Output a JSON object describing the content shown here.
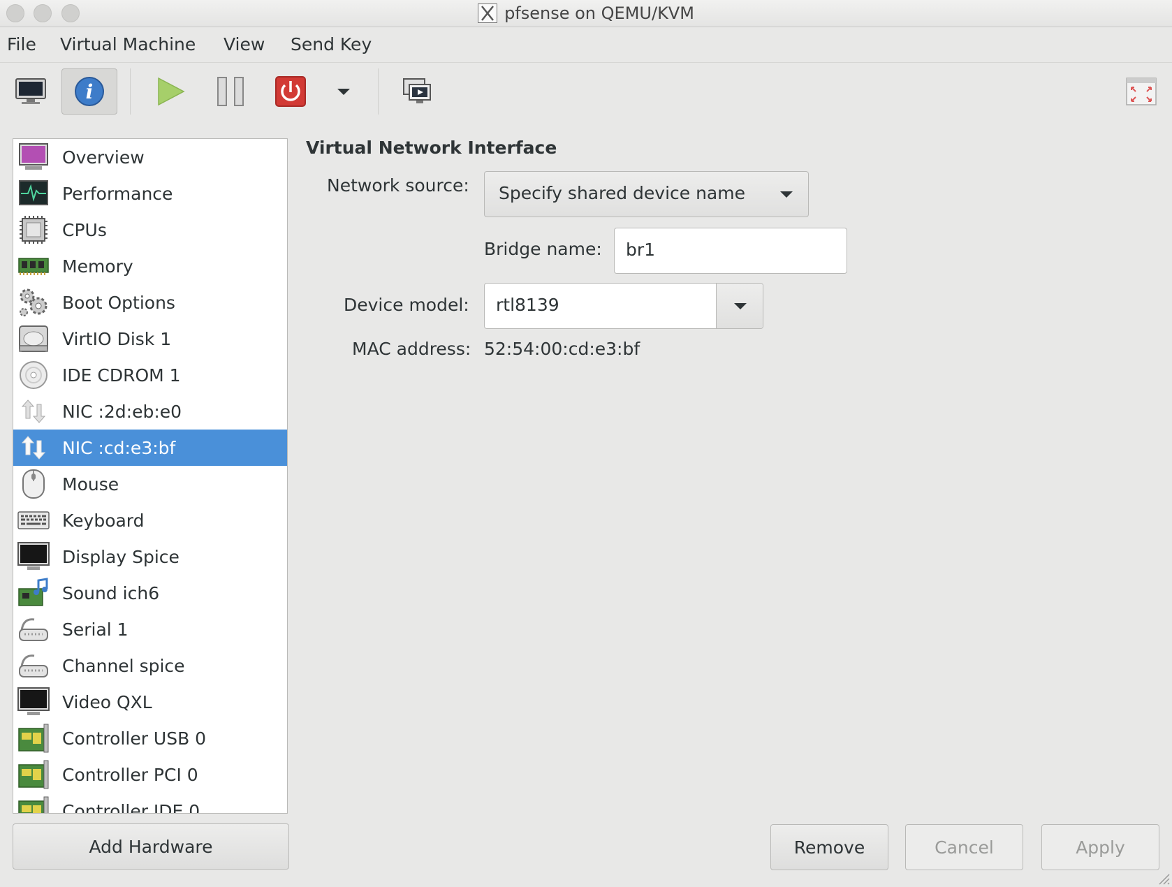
{
  "window": {
    "title": "pfsense on QEMU/KVM"
  },
  "menu": {
    "items": [
      "File",
      "Virtual Machine",
      "View",
      "Send Key"
    ]
  },
  "toolbar": {
    "buttons": [
      "console-icon",
      "info-icon",
      "play-icon",
      "pause-icon",
      "power-icon",
      "dropdown-icon",
      "snapshot-icon",
      "fullscreen-icon"
    ],
    "active": "info-icon"
  },
  "hardware": {
    "items": [
      {
        "label": "Overview",
        "icon": "overview-icon"
      },
      {
        "label": "Performance",
        "icon": "performance-icon"
      },
      {
        "label": "CPUs",
        "icon": "cpu-icon"
      },
      {
        "label": "Memory",
        "icon": "memory-icon"
      },
      {
        "label": "Boot Options",
        "icon": "gears-icon"
      },
      {
        "label": "VirtIO Disk 1",
        "icon": "disk-icon"
      },
      {
        "label": "IDE CDROM 1",
        "icon": "cdrom-icon"
      },
      {
        "label": "NIC :2d:eb:e0",
        "icon": "nic-icon"
      },
      {
        "label": "NIC :cd:e3:bf",
        "icon": "nic-icon"
      },
      {
        "label": "Mouse",
        "icon": "mouse-icon"
      },
      {
        "label": "Keyboard",
        "icon": "keyboard-icon"
      },
      {
        "label": "Display Spice",
        "icon": "display-icon"
      },
      {
        "label": "Sound ich6",
        "icon": "sound-icon"
      },
      {
        "label": "Serial 1",
        "icon": "serial-icon"
      },
      {
        "label": "Channel spice",
        "icon": "channel-icon"
      },
      {
        "label": "Video QXL",
        "icon": "video-icon"
      },
      {
        "label": "Controller USB 0",
        "icon": "controller-icon"
      },
      {
        "label": "Controller PCI 0",
        "icon": "controller-icon"
      },
      {
        "label": "Controller IDE 0",
        "icon": "controller-icon"
      }
    ],
    "selected": "NIC :cd:e3:bf",
    "add_button": "Add Hardware"
  },
  "detail": {
    "section_title": "Virtual Network Interface",
    "network_source_label": "Network source:",
    "network_source_value": "Specify shared device name",
    "bridge_name_label": "Bridge name:",
    "bridge_name_value": "br1",
    "device_model_label": "Device model:",
    "device_model_value": "rtl8139",
    "mac_address_label": "MAC address:",
    "mac_address_value": "52:54:00:cd:e3:bf"
  },
  "buttons": {
    "remove": "Remove",
    "cancel": "Cancel",
    "apply": "Apply"
  },
  "colors": {
    "selection": "#4a90d9",
    "power_red": "#d23a35",
    "info_blue": "#3d7cc9",
    "play_green": "#a6cf6a"
  }
}
